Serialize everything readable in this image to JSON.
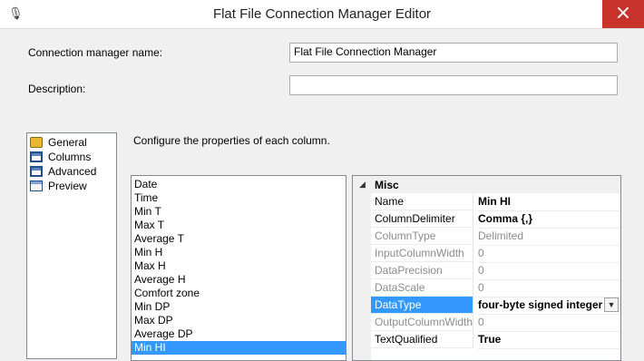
{
  "window": {
    "title": "Flat File Connection Manager Editor",
    "close_glyph": "×",
    "icon_glyph": "🎙"
  },
  "form": {
    "conn_name_label": "Connection manager name:",
    "conn_name_value": "Flat File Connection Manager",
    "description_label": "Description:",
    "description_value": ""
  },
  "nav": {
    "items": [
      {
        "label": "General",
        "icon": "general-icon"
      },
      {
        "label": "Columns",
        "icon": "columns-icon"
      },
      {
        "label": "Advanced",
        "icon": "advanced-icon"
      },
      {
        "label": "Preview",
        "icon": "preview-icon"
      }
    ]
  },
  "main": {
    "instruction": "Configure the properties of each column.",
    "columns": [
      "Date",
      "Time",
      "Min T",
      "Max T",
      "Average T",
      "Min H",
      "Max H",
      "Average H",
      "Comfort zone",
      "Min DP",
      "Max DP",
      "Average DP",
      "Min HI"
    ],
    "selected_column": "Min HI"
  },
  "properties": {
    "category": "Misc",
    "category_arrow": "◢",
    "dropdown_arrow": "▼",
    "rows": [
      {
        "name": "Name",
        "value": "Min HI"
      },
      {
        "name": "ColumnDelimiter",
        "value": "Comma {,}"
      },
      {
        "name": "ColumnType",
        "value": "Delimited"
      },
      {
        "name": "InputColumnWidth",
        "value": "0"
      },
      {
        "name": "DataPrecision",
        "value": "0"
      },
      {
        "name": "DataScale",
        "value": "0"
      },
      {
        "name": "DataType",
        "value": "four-byte signed integer"
      },
      {
        "name": "OutputColumnWidth",
        "value": "0"
      },
      {
        "name": "TextQualified",
        "value": "True"
      }
    ],
    "selected_property": "DataType"
  }
}
